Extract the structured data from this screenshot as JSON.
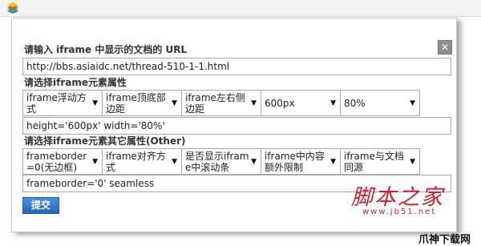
{
  "toolbar": {
    "icon": "layers-icon"
  },
  "dialog": {
    "close_icon": "close-icon",
    "close_glyph": "✕",
    "url_label": "请输入 iframe 中显示的文档的 URL",
    "url_value": "http://bbs.asiaidc.net/thread-510-1-1.html",
    "attr_label": "请选择iframe元素属性",
    "attr_selects": [
      "iframe浮动方式",
      "iframe顶底部边距",
      "iframe左右侧边距",
      "600px",
      "80%"
    ],
    "attr_value": "height='600px' width='80%'",
    "other_label": "请选择iframe元素其它属性(Other)",
    "other_selects": [
      "frameborder=0(无边框)",
      "iframe对齐方式",
      "是否显示iframe中滚动条",
      "iframe中内容额外限制",
      "iframe与文档同源"
    ],
    "other_value": "frameborder='0' seamless",
    "submit_label": "提交"
  },
  "watermarks": {
    "brand": "脚本之家",
    "url": "www.jb51.net",
    "corner": "爪神下载网"
  },
  "colors": {
    "button": "#2866b8",
    "watermark": "#c8232c",
    "close": "#8d8d8d"
  }
}
